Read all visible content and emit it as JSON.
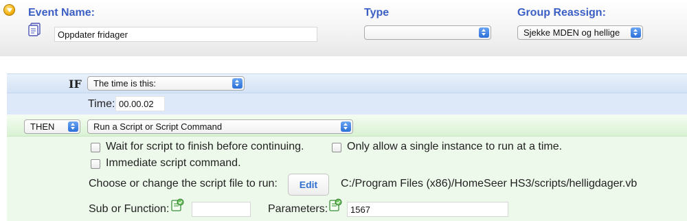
{
  "header": {
    "event_name_label": "Event Name:",
    "type_label": "Type",
    "group_reassign_label": "Group Reassign:",
    "event_name_value": "Oppdater fridager",
    "type_value": "",
    "group_reassign_value": "Sjekke MDEN og hellige"
  },
  "if_block": {
    "keyword": "IF",
    "trigger_value": "The time is this:",
    "time_label": "Time:",
    "time_value": "00.00.02"
  },
  "then_block": {
    "keyword_value": "THEN",
    "action_value": "Run a Script or Script Command",
    "wait_label": "Wait for script to finish before continuing.",
    "single_instance_label": "Only allow a single instance to run at a time.",
    "immediate_label": "Immediate script command.",
    "choose_label": "Choose or change the script file to run:",
    "edit_label": "Edit",
    "script_path": "C:/Program Files (x86)/HomeSeer HS3/scripts/helligdager.vb",
    "sub_label": "Sub or Function:",
    "sub_value": "",
    "params_label": "Parameters:",
    "params_value": "1567"
  },
  "colors": {
    "label_blue": "#3b5fc4",
    "if_band": "#dde9f8",
    "then_band": "#edf9ea"
  },
  "icons": {
    "collapse": "chevron-down-icon",
    "event": "document-icon",
    "script_picker": "script-picker-icon"
  }
}
